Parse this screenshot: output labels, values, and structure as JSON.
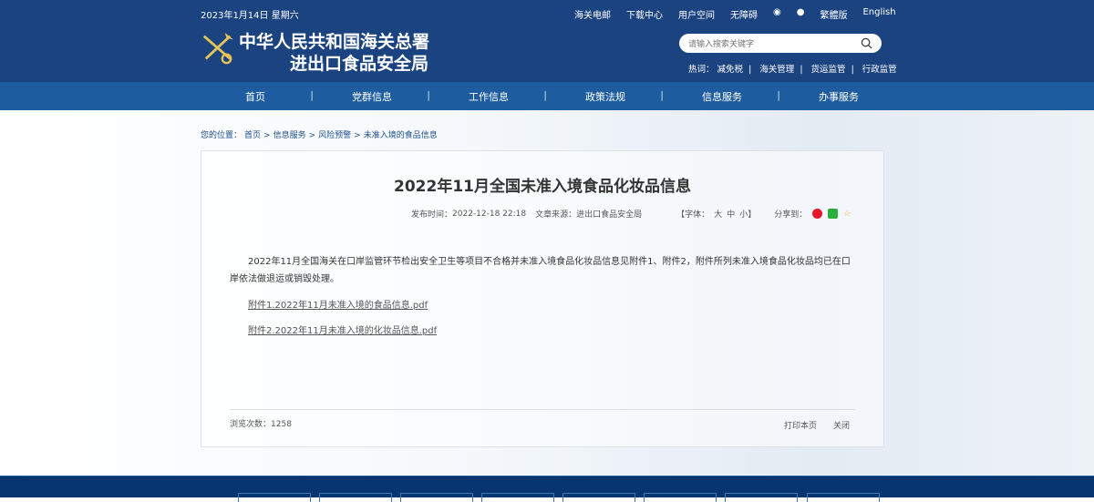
{
  "header": {
    "date": "2023年1月14日 星期六",
    "logo_line1": "中华人民共和国海关总署",
    "logo_line2": "进出口食品安全局",
    "top_links": [
      "海关电邮",
      "下载中心",
      "用户空间",
      "无障碍"
    ],
    "lang_trad": "繁體版",
    "lang_en": "English",
    "search_placeholder": "请输入搜索关键字",
    "hot_label": "热词：",
    "hot_words": [
      "减免税",
      "海关管理",
      "货运监管",
      "行政监管"
    ]
  },
  "nav": [
    "首页",
    "党群信息",
    "工作信息",
    "政策法规",
    "信息服务",
    "办事服务"
  ],
  "breadcrumb": {
    "label": "您的位置：",
    "items": [
      "首页",
      "信息服务",
      "风险预警",
      "未准入境的食品信息"
    ]
  },
  "article": {
    "title": "2022年11月全国未准入境食品化妆品信息",
    "publish_label": "发布时间：",
    "publish_time": "2022-12-18 22:18",
    "source_label": "文章来源：",
    "source": "进出口食品安全局",
    "font_label": "【字体：",
    "font_sizes": [
      "大",
      "中",
      "小"
    ],
    "font_end": "】",
    "share_label": "分享到：",
    "body": "2022年11月全国海关在口岸监管环节检出安全卫生等项目不合格并未准入境食品化妆品信息见附件1、附件2，附件所列未准入境食品化妆品均已在口岸依法做退运或销毁处理。",
    "attachments": [
      "附件1.2022年11月未准入境的食品信息.pdf",
      "附件2.2022年11月未准入境的化妆品信息.pdf"
    ],
    "views_label": "浏览次数：",
    "views": "1258",
    "print": "打印本页",
    "close": "关闭"
  },
  "colors": {
    "header": "#1b4380",
    "nav": "#1d5c9f",
    "footer": "#07356f"
  }
}
